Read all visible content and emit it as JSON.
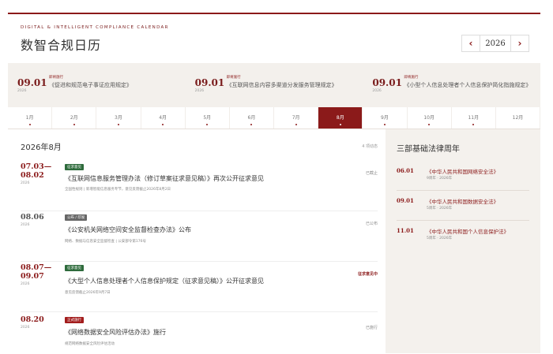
{
  "header": {
    "eyebrow": "DIGITAL & INTELLIGENT COMPLIANCE CALENDAR",
    "title": "数智合规日历",
    "year": "2026",
    "prev": "‹",
    "next": "›"
  },
  "featured": [
    {
      "tag": "即将施行",
      "date": "09.01",
      "year": "2026",
      "text": "《促进和规范电子事证应用规定》"
    },
    {
      "tag": "即将施行",
      "date": "09.01",
      "year": "2026",
      "text": "《互联网信息内容多渠道分发服务管理规定》"
    },
    {
      "tag": "即将施行",
      "date": "09.01",
      "year": "2026",
      "text": "《小型个人信息处理者个人信息保护简化指施规定》"
    }
  ],
  "months": [
    "1月",
    "2月",
    "3月",
    "4月",
    "5月",
    "6月",
    "7月",
    "8月",
    "9月",
    "10月",
    "11月",
    "12月"
  ],
  "active_month": 7,
  "list": {
    "heading": "2026年8月",
    "count": "4 项动态",
    "items": [
      {
        "date": "07.03—\n08.02",
        "year": "2026",
        "tag": "征求意见",
        "tag_color": "green",
        "title": "《互联网信息服务管理办法（修订草案征求意见稿）》再次公开征求意见",
        "sub": "全国性规则 | 新增智能信息服务专节，意见反馈截止2026年8月2日",
        "status": "已截止",
        "hot": false
      },
      {
        "date": "08.06",
        "year": "2026",
        "tag": "公布 / 印发",
        "tag_color": "gray",
        "title": "《公安机关网络空间安全监督检查办法》公布",
        "sub": "网络、数据与信息安全监督检查 | 公安部令第176号",
        "status": "已公布",
        "hot": false
      },
      {
        "date": "08.07—\n09.07",
        "year": "2026",
        "tag": "征求意见",
        "tag_color": "green",
        "title": "《大型个人信息处理者个人信息保护规定（征求意见稿）》公开征求意见",
        "sub": "意见反馈截止2026年9月7日",
        "status": "征求意见中",
        "hot": true
      },
      {
        "date": "08.20",
        "year": "2026",
        "tag": "正式施行",
        "tag_color": "red",
        "title": "《网络数据安全风险评估办法》施行",
        "sub": "规范网络数据安全风险评估活动",
        "status": "已施行",
        "hot": false
      }
    ]
  },
  "panel": {
    "title": "三部基础法律周年",
    "laws": [
      {
        "date": "06.01",
        "name": "《中华人民共和国网络安全法》",
        "sub": "9周年 · 2026年"
      },
      {
        "date": "09.01",
        "name": "《中华人民共和国数据安全法》",
        "sub": "5周年 · 2026年"
      },
      {
        "date": "11.01",
        "name": "《中华人民共和国个人信息保护法》",
        "sub": "5周年 · 2026年"
      }
    ]
  }
}
